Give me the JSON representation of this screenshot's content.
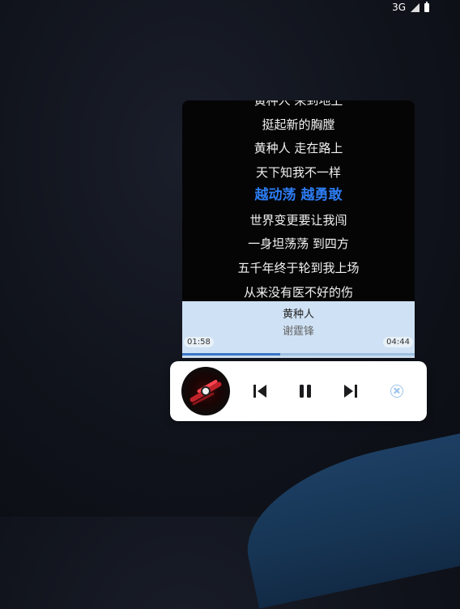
{
  "status_bar": {
    "network": "3G"
  },
  "lyrics": [
    {
      "text": "黄种人 来到地上"
    },
    {
      "text": "挺起新的胸膛"
    },
    {
      "text": "黄种人 走在路上"
    },
    {
      "text": "天下知我不一样"
    },
    {
      "text": "越动荡 越勇敢",
      "current": true
    },
    {
      "text": "世界变更要让我闯"
    },
    {
      "text": "一身坦荡荡 到四方"
    },
    {
      "text": "五千年终于轮到我上场"
    },
    {
      "text": "从来没有医不好的伤"
    }
  ],
  "player": {
    "song_title": "黄种人",
    "artist": "谢霆锋",
    "current_time": "01:58",
    "total_time": "04:44",
    "progress": 0.42
  },
  "colors": {
    "accent": "#2c7cf1",
    "panel": "#cfe1f4"
  }
}
